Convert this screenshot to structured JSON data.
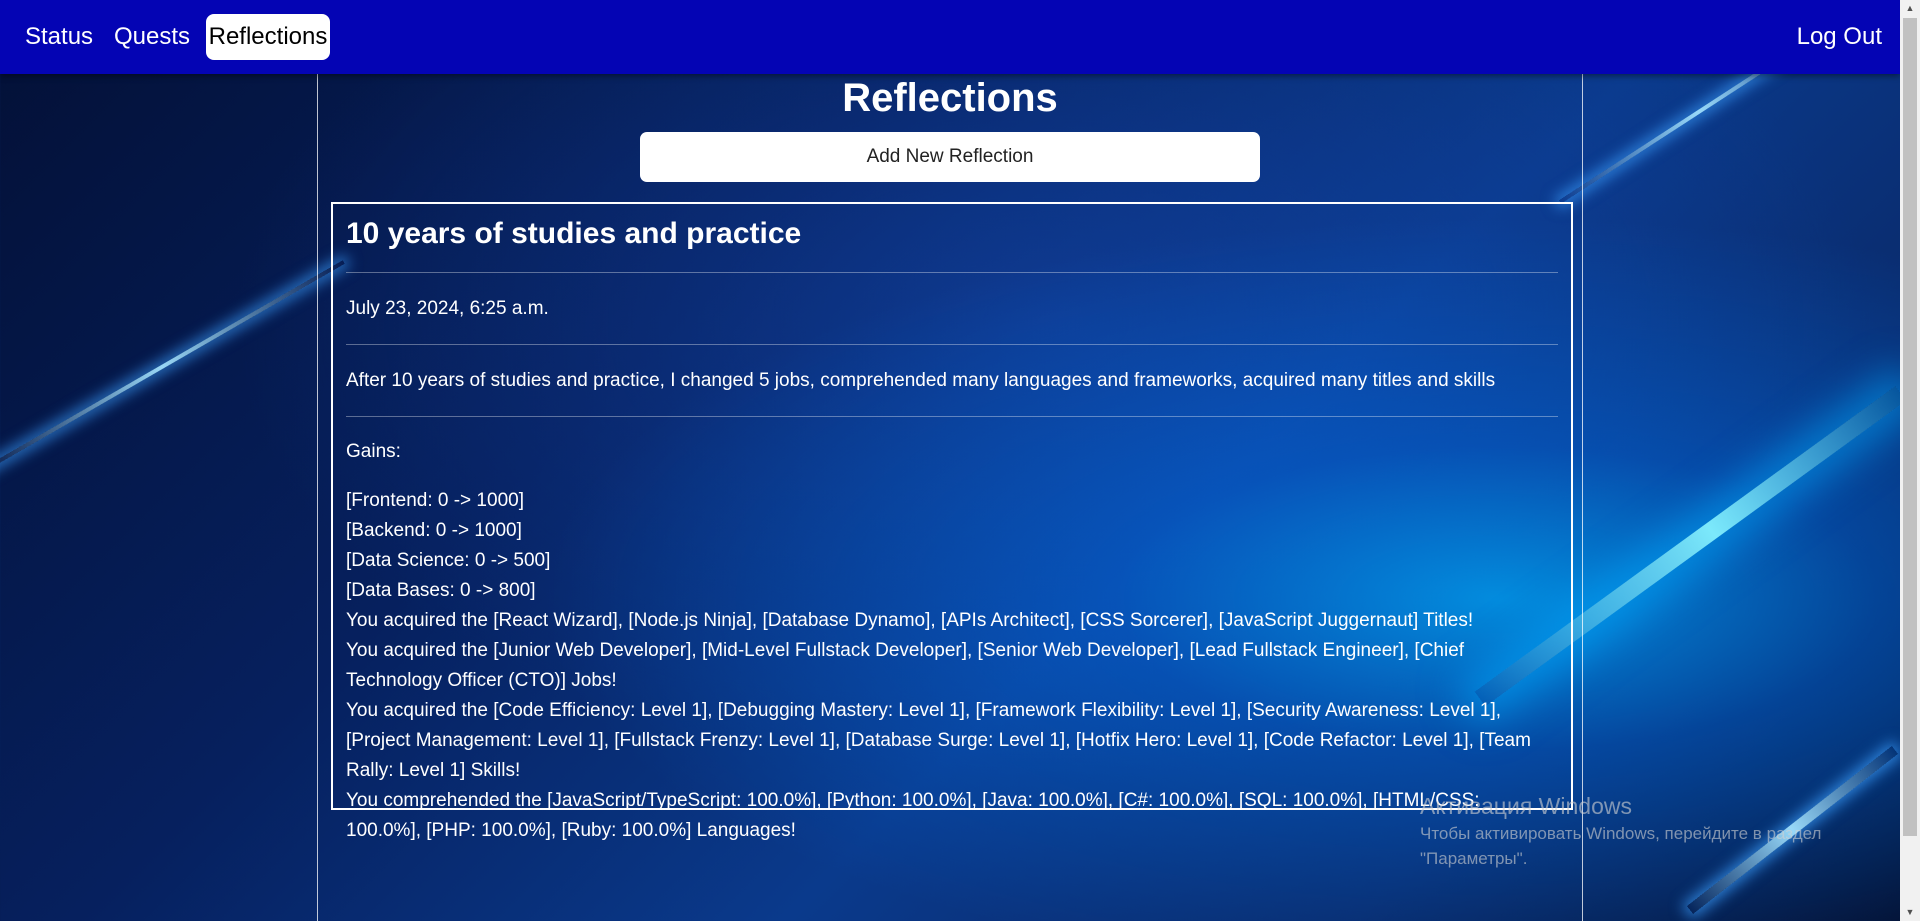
{
  "nav": {
    "status": "Status",
    "quests": "Quests",
    "reflections": "Reflections",
    "logout": "Log Out"
  },
  "page": {
    "title": "Reflections",
    "add_button": "Add New Reflection"
  },
  "reflection": {
    "title": "10 years of studies and practice",
    "date": "July 23, 2024, 6:25 a.m.",
    "summary": "After 10 years of studies and practice, I changed 5 jobs, comprehended many languages and frameworks, acquired many titles and skills",
    "gains_label": "Gains:",
    "gains": [
      "[Frontend: 0 -> 1000]",
      "[Backend: 0 -> 1000]",
      "[Data Science: 0 -> 500]",
      "[Data Bases: 0 -> 800]",
      "You acquired the [React Wizard], [Node.js Ninja], [Database Dynamo], [APIs Architect], [CSS Sorcerer], [JavaScript Juggernaut] Titles!",
      "You acquired the [Junior Web Developer], [Mid-Level Fullstack Developer], [Senior Web Developer], [Lead Fullstack Engineer], [Chief Technology Officer (CTO)] Jobs!",
      "You acquired the [Code Efficiency: Level 1], [Debugging Mastery: Level 1], [Framework Flexibility: Level 1], [Security Awareness: Level 1], [Project Management: Level 1], [Fullstack Frenzy: Level 1], [Database Surge: Level 1], [Hotfix Hero: Level 1], [Code Refactor: Level 1], [Team Rally: Level 1] Skills!",
      "You comprehended the [JavaScript/TypeScript: 100.0%], [Python: 100.0%], [Java: 100.0%], [C#: 100.0%], [SQL: 100.0%], [HTML/CSS: 100.0%], [PHP: 100.0%], [Ruby: 100.0%] Languages!"
    ]
  },
  "watermark": {
    "title": "Активация Windows",
    "line1": "Чтобы активировать Windows, перейдите в раздел",
    "line2": "\"Параметры\"."
  },
  "colors": {
    "navbar": "#0404b4",
    "active_tab_bg": "#ffffff",
    "card_border": "#ffffff"
  }
}
